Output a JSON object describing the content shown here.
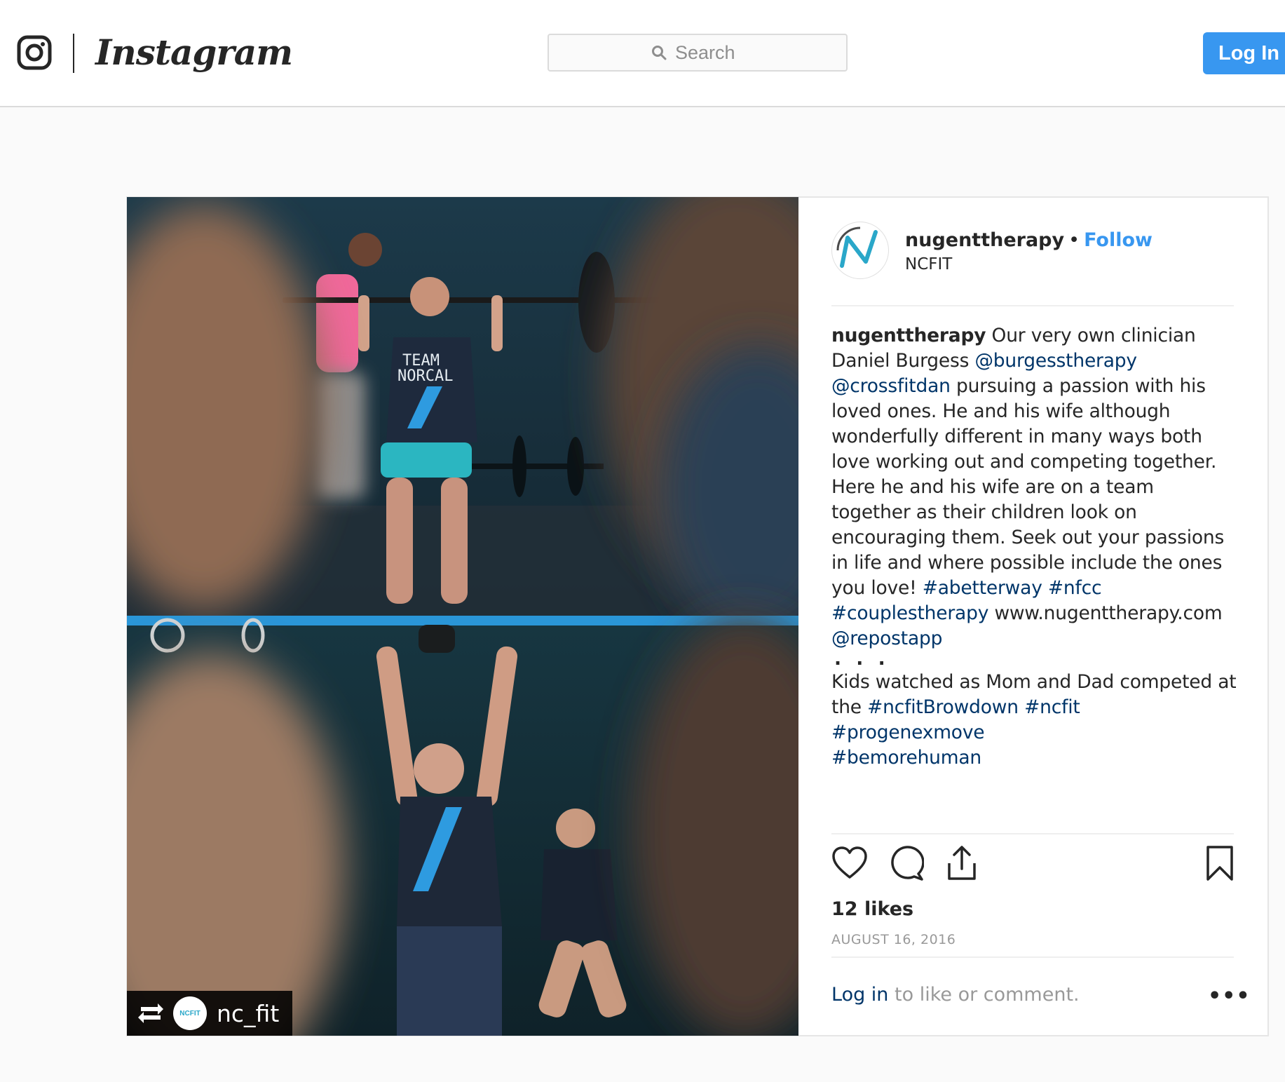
{
  "header": {
    "brand": "Instagram",
    "search_placeholder": "Search",
    "login_label": "Log In"
  },
  "post": {
    "username": "nugenttherapy",
    "separator": "•",
    "follow_label": "Follow",
    "location": "NCFIT",
    "repost_handle": "nc_fit",
    "repost_logo_text": "NCFIT",
    "shirt_text_line1": "TEAM",
    "shirt_text_line2": "NORCAL",
    "caption": {
      "author": "nugenttherapy",
      "t1": " Our very own clinician Daniel Burgess ",
      "m1": "@burgesstherapy",
      "t2": " ",
      "m2": "@crossfitdan",
      "t3": " pursuing a passion with his loved ones. He and his wife although wonderfully different in many ways both love working out and competing together. Here he and his wife are on a team together as their children look on encouraging them. Seek out your passions in life and where possible include the ones you love! ",
      "h1": "#abetterway",
      "t4": " ",
      "h2": "#nfcc",
      "t5": " ",
      "h3": "#couplestherapy",
      "t6": " www.nugenttherapy.com ",
      "m3": "@repostapp",
      "dots": ". . .",
      "t7": "Kids watched as Mom and Dad competed at the ",
      "h4": "#ncfitBrowdown",
      "t8": " ",
      "h5": "#ncfit",
      "t9": " ",
      "h6": "#progenexmove",
      "h7": "#bemorehuman"
    },
    "likes": "12 likes",
    "date": "AUGUST 16, 2016",
    "login_link": "Log in",
    "login_rest": " to like or comment.",
    "more_label": "•••"
  },
  "icons": {
    "camera": "instagram-camera-icon",
    "search": "search-icon",
    "like": "heart-icon",
    "comment": "comment-icon",
    "share": "share-icon",
    "save": "bookmark-icon",
    "repost": "repost-icon"
  }
}
